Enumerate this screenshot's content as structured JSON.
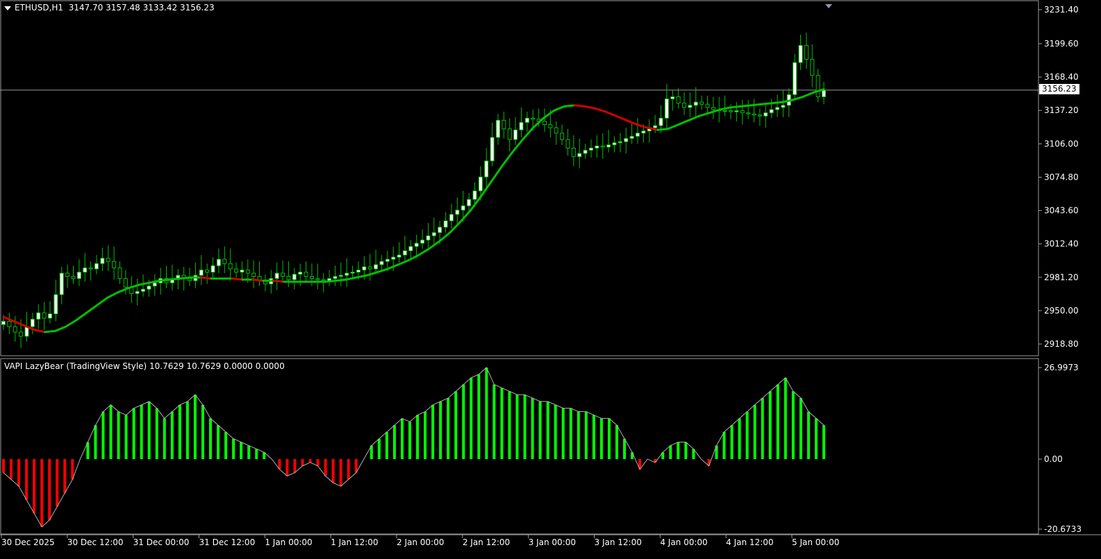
{
  "window": {
    "symbol_label": "ETHUSD,H1",
    "ohlc": "3147.70 3157.48 3133.42 3156.23"
  },
  "current_price": "3156.23",
  "price_axis": [
    "3231.40",
    "3199.60",
    "3168.40",
    "3137.20",
    "3106.00",
    "3074.80",
    "3043.60",
    "3012.40",
    "2981.20",
    "2950.00",
    "2918.80"
  ],
  "indicator": {
    "label": "VAPI LazyBear (TradingView Style) 10.7629 10.7629 0.0000 0.0000",
    "axis": [
      "26.9973",
      "0.00",
      "-20.6733"
    ]
  },
  "time_axis": [
    "30 Dec 2025",
    "30 Dec 12:00",
    "31 Dec 00:00",
    "31 Dec 12:00",
    "1 Jan 00:00",
    "1 Jan 12:00",
    "2 Jan 00:00",
    "2 Jan 12:00",
    "3 Jan 00:00",
    "3 Jan 12:00",
    "4 Jan 00:00",
    "4 Jan 12:00",
    "5 Jan 00:00"
  ],
  "colors": {
    "background": "#000000",
    "bull_candle": "#ffffff",
    "wick": "#00c000",
    "ma_up": "#00c000",
    "ma_down": "#d00000",
    "hist_pos": "#00ff00",
    "hist_neg": "#ff0000",
    "hist_line": "#b0b0b0"
  },
  "chart_data": {
    "type": "line",
    "candles_close": [
      2940,
      2935,
      2930,
      2926,
      2935,
      2942,
      2948,
      2943,
      2947,
      2965,
      2985,
      2982,
      2980,
      2986,
      2990,
      2989,
      2994,
      2999,
      2996,
      2990,
      2980,
      2972,
      2966,
      2968,
      2970,
      2973,
      2976,
      2980,
      2976,
      2979,
      2983,
      2980,
      2978,
      2983,
      2988,
      2986,
      2992,
      2998,
      2994,
      2989,
      2986,
      2988,
      2985,
      2982,
      2978,
      2975,
      2980,
      2985,
      2982,
      2979,
      2984,
      2986,
      2982,
      2980,
      2979,
      2978,
      2980,
      2982,
      2983,
      2985,
      2986,
      2988,
      2991,
      2989,
      2993,
      2996,
      2998,
      3000,
      3002,
      3006,
      3010,
      3013,
      3016,
      3020,
      3023,
      3028,
      3034,
      3040,
      3044,
      3048,
      3054,
      3062,
      3075,
      3090,
      3112,
      3128,
      3120,
      3110,
      3119,
      3126,
      3130,
      3129,
      3127,
      3124,
      3121,
      3116,
      3110,
      3102,
      3094,
      3097,
      3100,
      3102,
      3104,
      3103,
      3105,
      3107,
      3108,
      3111,
      3113,
      3116,
      3118,
      3121,
      3123,
      3130,
      3148,
      3150,
      3144,
      3140,
      3142,
      3145,
      3143,
      3140,
      3138,
      3137,
      3137,
      3136,
      3137,
      3135,
      3134,
      3133,
      3132,
      3135,
      3138,
      3140,
      3142,
      3152,
      3182,
      3198,
      3185,
      3170,
      3150,
      3156
    ],
    "ma_values": [
      2944,
      2940,
      2936,
      2932,
      2930,
      2931,
      2935,
      2941,
      2948,
      2955,
      2962,
      2967,
      2971,
      2974,
      2976,
      2978,
      2979,
      2980,
      2981,
      2981,
      2980,
      2980,
      2980,
      2979,
      2979,
      2978,
      2978,
      2977,
      2977,
      2977,
      2977,
      2977,
      2978,
      2979,
      2981,
      2983,
      2986,
      2989,
      2993,
      2997,
      3002,
      3008,
      3015,
      3023,
      3033,
      3044,
      3057,
      3071,
      3085,
      3098,
      3110,
      3121,
      3130,
      3137,
      3141,
      3142,
      3141,
      3139,
      3136,
      3132,
      3128,
      3124,
      3121,
      3119,
      3120,
      3124,
      3128,
      3132,
      3135,
      3138,
      3140,
      3141,
      3142,
      3143,
      3144,
      3145,
      3147,
      3150,
      3154,
      3157
    ],
    "vapi_values": [
      -4,
      -6,
      -8,
      -12,
      -16,
      -20,
      -18,
      -14,
      -10,
      -6,
      0,
      5,
      10,
      14,
      16,
      14,
      13,
      15,
      16,
      17,
      15,
      12,
      14,
      16,
      17,
      19,
      16,
      12,
      10,
      8,
      6,
      5,
      4,
      3,
      2,
      0,
      -3,
      -5,
      -4,
      -2,
      -1,
      -2,
      -5,
      -7,
      -8,
      -6,
      -4,
      0,
      4,
      6,
      8,
      10,
      12,
      11,
      13,
      14,
      16,
      17,
      18,
      20,
      22,
      24,
      25,
      27,
      22,
      21,
      20,
      19,
      19,
      18,
      17,
      17,
      16,
      15,
      15,
      14,
      14,
      13,
      12,
      12,
      10,
      6,
      2,
      -3,
      0,
      -1,
      2,
      4,
      5,
      5,
      3,
      0,
      -2,
      4,
      8,
      10,
      12,
      14,
      16,
      18,
      20,
      22,
      24,
      20,
      18,
      14,
      12,
      10
    ],
    "ylim": [
      2918.8,
      3231.4
    ],
    "vapi_ylim": [
      -20.6733,
      26.9973
    ]
  }
}
